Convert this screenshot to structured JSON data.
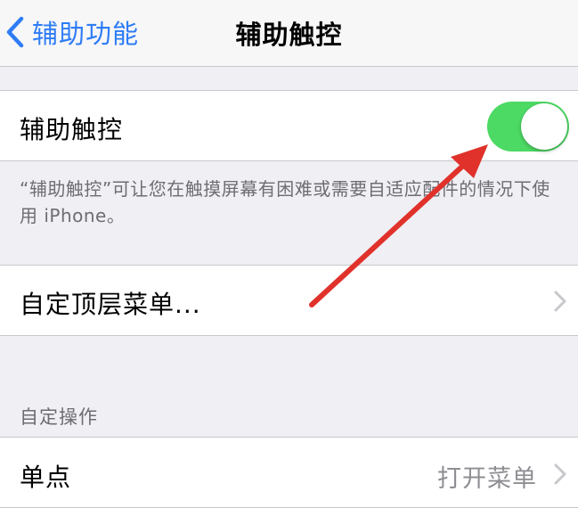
{
  "colors": {
    "accent": "#2e7cf6",
    "toggle_on": "#4cd964",
    "secondary_text": "#6d6d72",
    "value_text": "#8e8e93",
    "chevron": "#c7c7cc",
    "annotation": "#e0322b"
  },
  "navbar": {
    "back_label": "辅助功能",
    "title": "辅助触控"
  },
  "assistive_touch": {
    "label": "辅助触控",
    "toggle_on": true,
    "footer": "“辅助触控”可让您在触摸屏幕有困难或需要自适应配件的情况下使用 iPhone。"
  },
  "custom_menu": {
    "label": "自定顶层菜单..."
  },
  "custom_actions": {
    "header": "自定操作",
    "single_tap": {
      "label": "单点",
      "value": "打开菜单"
    }
  }
}
